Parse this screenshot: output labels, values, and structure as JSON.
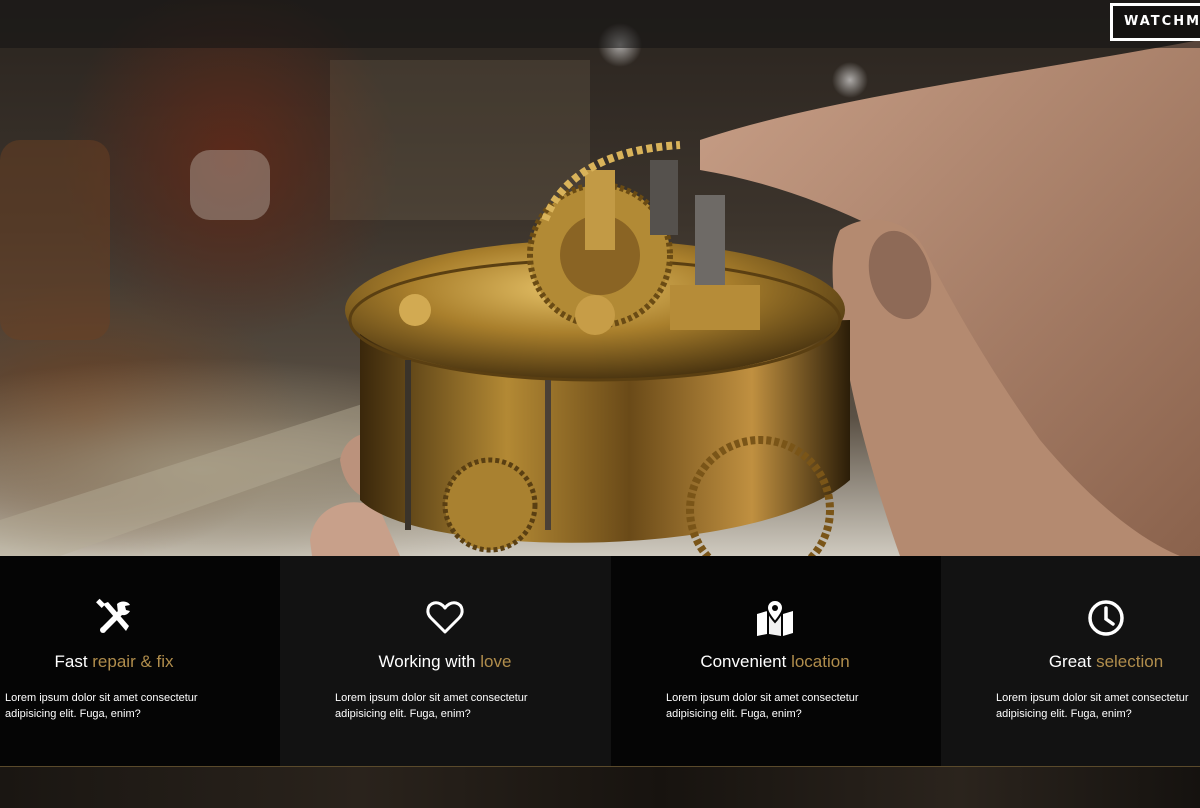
{
  "header": {
    "logo_text": "WATCHMA"
  },
  "hero": {
    "image_alt": "Watchmaker holding brass clock movement"
  },
  "features": [
    {
      "icon": "tools-icon",
      "title_plain": "Fast ",
      "title_accent": "repair & fix",
      "text": "Lorem ipsum dolor sit amet consectetur adipisicing elit. Fuga, enim?"
    },
    {
      "icon": "heart-icon",
      "title_plain": "Working with ",
      "title_accent": "love",
      "text": "Lorem ipsum dolor sit amet consectetur adipisicing elit. Fuga, enim?"
    },
    {
      "icon": "map-icon",
      "title_plain": "Convenient ",
      "title_accent": "location",
      "text": "Lorem ipsum dolor sit amet consectetur adipisicing elit. Fuga, enim?"
    },
    {
      "icon": "clock-icon",
      "title_plain": "Great ",
      "title_accent": "selection",
      "text": "Lorem ipsum dolor sit amet consectetur adipisicing elit. Fuga, enim?"
    }
  ],
  "colors": {
    "accent": "#b08d4c",
    "dark_panel": "#050505",
    "light_panel": "#121212"
  }
}
